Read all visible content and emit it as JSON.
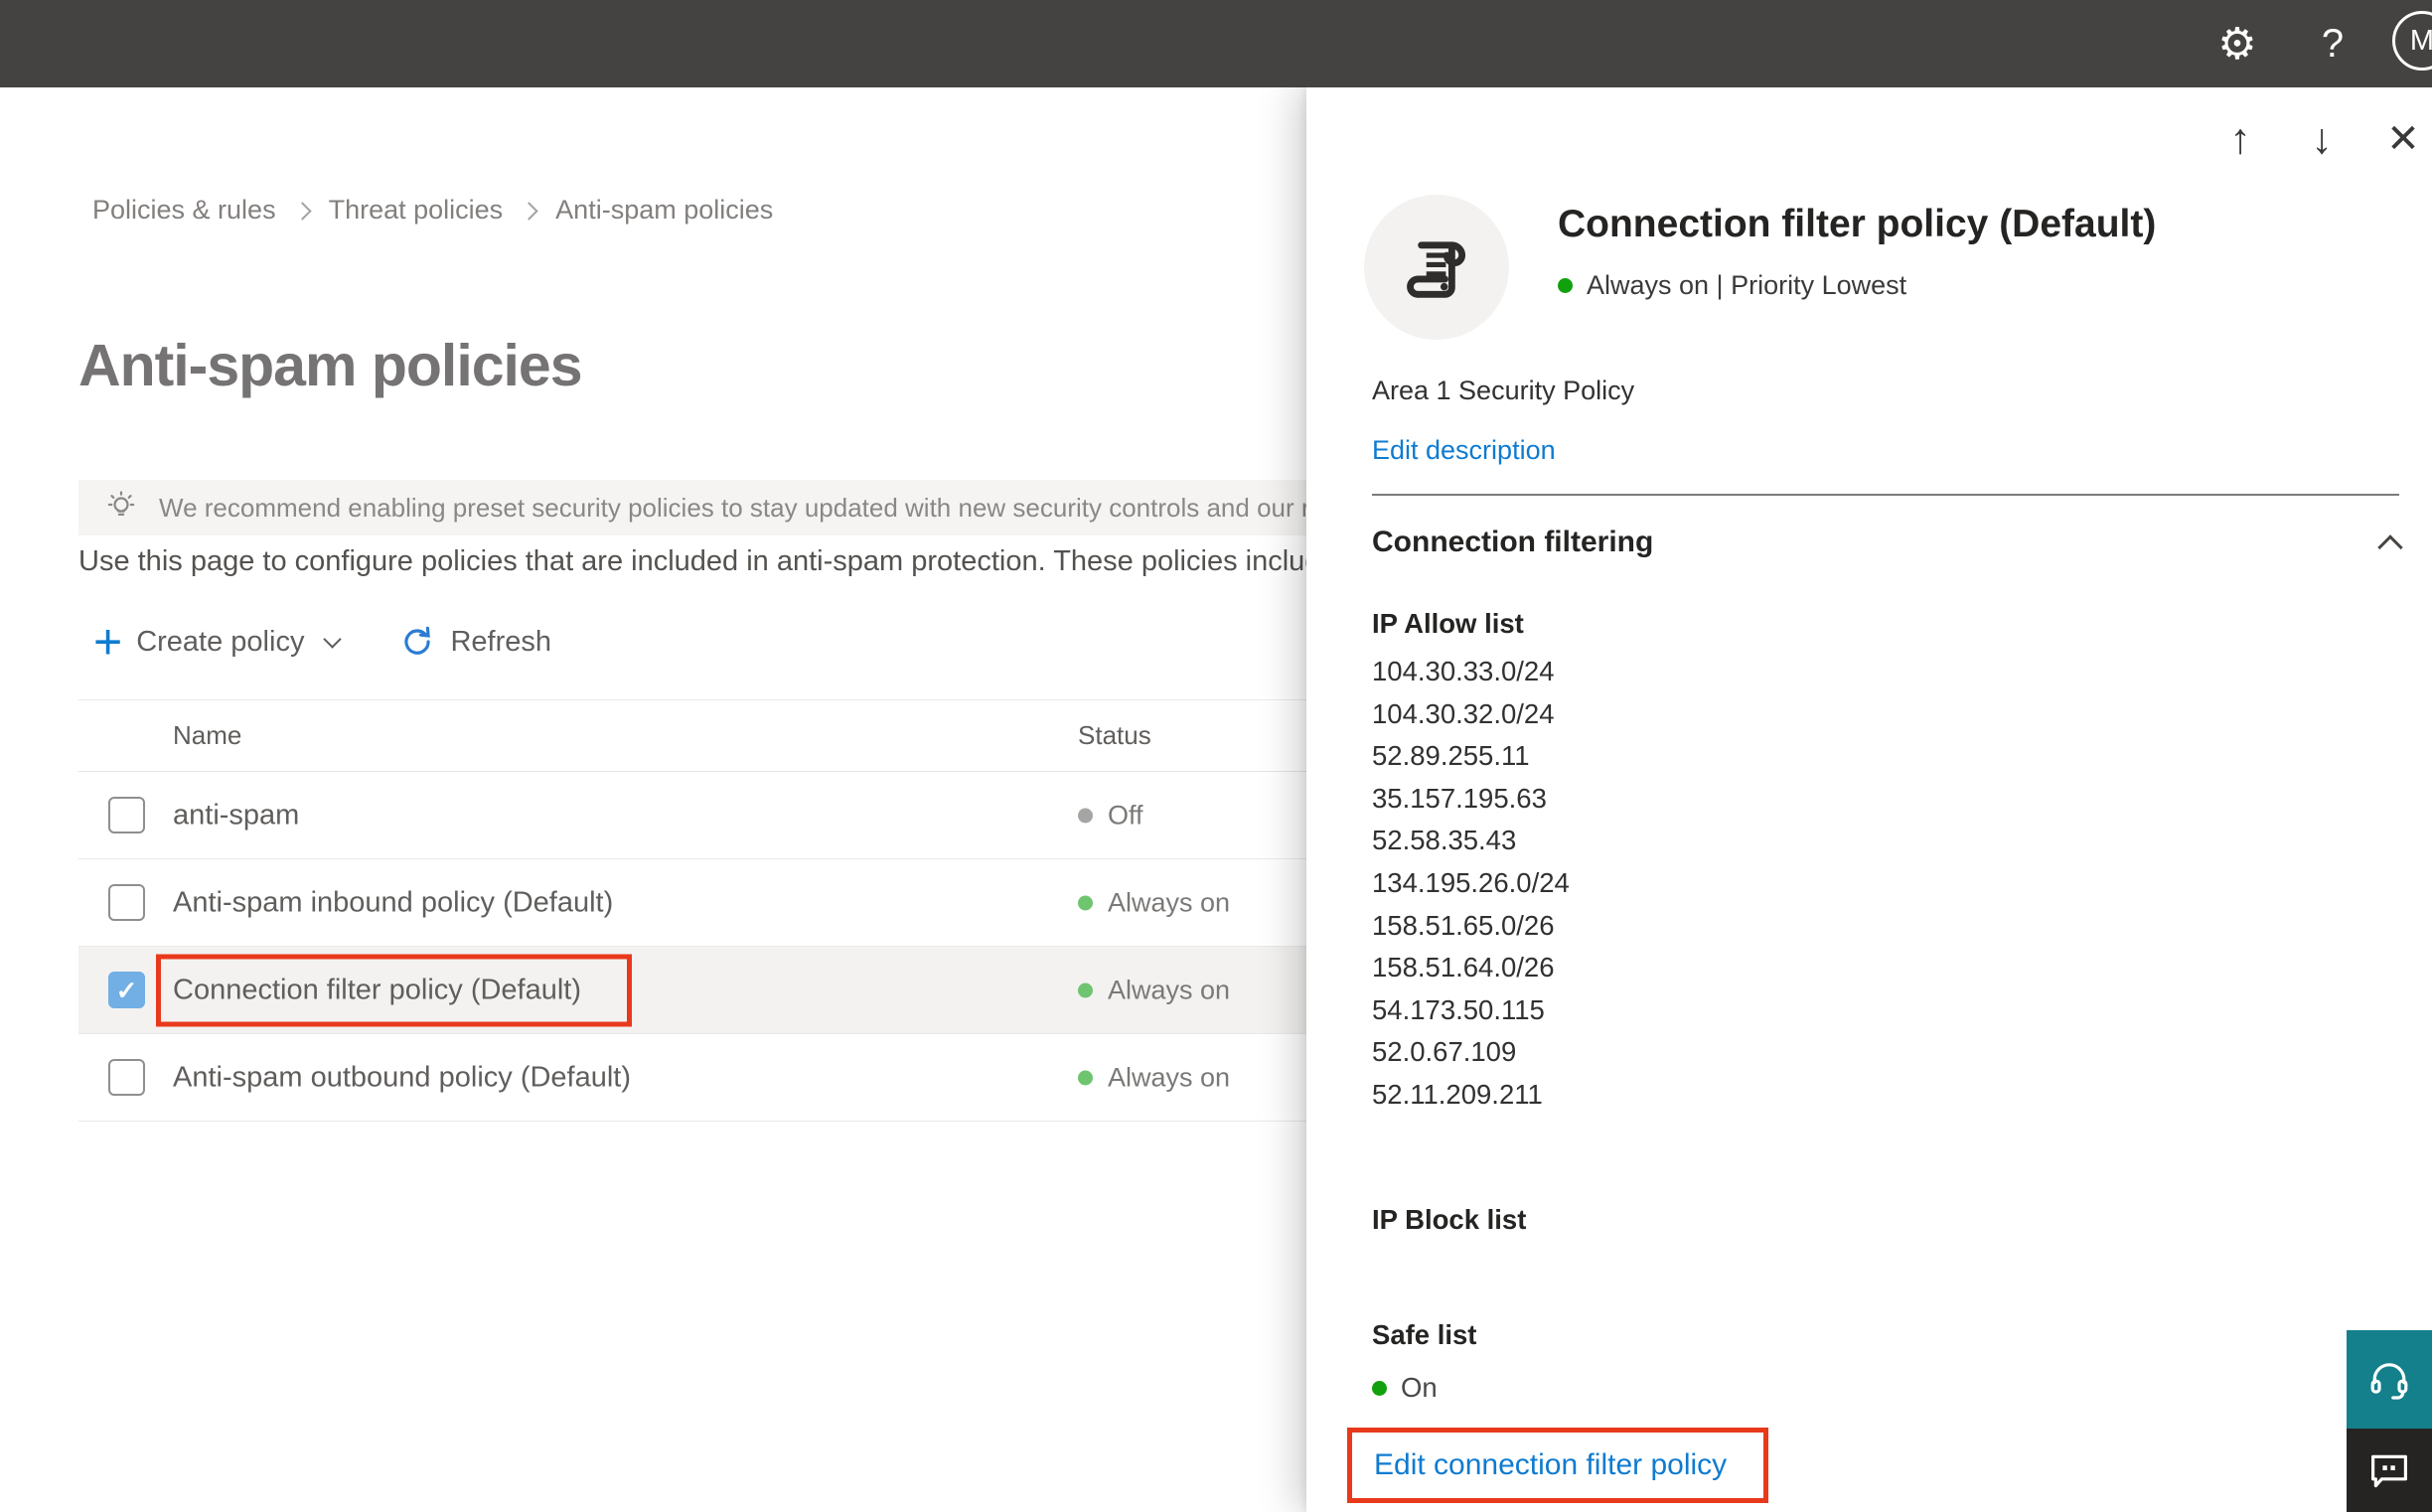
{
  "topbar": {
    "avatar_initial": "M"
  },
  "breadcrumb": {
    "items": [
      "Policies & rules",
      "Threat policies",
      "Anti-spam policies"
    ]
  },
  "page": {
    "title": "Anti-spam policies",
    "banner": "We recommend enabling preset security policies to stay updated with new security controls and our recomme",
    "description": "Use this page to configure policies that are included in anti-spam protection. These policies include"
  },
  "toolbar": {
    "create_label": "Create policy",
    "refresh_label": "Refresh"
  },
  "table": {
    "headers": [
      "Name",
      "Status"
    ],
    "rows": [
      {
        "name": "anti-spam",
        "status": "Off",
        "state": "off",
        "checked": false,
        "selected": false,
        "annotated": false
      },
      {
        "name": "Anti-spam inbound policy (Default)",
        "status": "Always on",
        "state": "on",
        "checked": false,
        "selected": false,
        "annotated": false
      },
      {
        "name": "Connection filter policy (Default)",
        "status": "Always on",
        "state": "on",
        "checked": true,
        "selected": true,
        "annotated": true
      },
      {
        "name": "Anti-spam outbound policy (Default)",
        "status": "Always on",
        "state": "on",
        "checked": false,
        "selected": false,
        "annotated": false
      }
    ]
  },
  "flyout": {
    "title": "Connection filter policy (Default)",
    "status_line": "Always on | Priority Lowest",
    "description": "Area 1 Security Policy",
    "edit_description_label": "Edit description",
    "section_title": "Connection filtering",
    "ip_allow_label": "IP Allow list",
    "ip_allow": [
      "104.30.33.0/24",
      "104.30.32.0/24",
      "52.89.255.11",
      "35.157.195.63",
      "52.58.35.43",
      "134.195.26.0/24",
      "158.51.65.0/26",
      "158.51.64.0/26",
      "54.173.50.115",
      "52.0.67.109",
      "52.11.209.211"
    ],
    "ip_block_label": "IP Block list",
    "safe_list_label": "Safe list",
    "safe_list_value": "On",
    "edit_link_label": "Edit connection filter policy"
  },
  "colors": {
    "topbar": "#454341",
    "accent": "#0f7bd0",
    "annotation": "#e8391c",
    "green-bright": "#12a10e",
    "green-soft": "#6fc56f",
    "dot-off": "#a7a5a3",
    "checkbox": "#71afe5",
    "teal": "#13808b",
    "selected-row": "#f3f2f1"
  }
}
